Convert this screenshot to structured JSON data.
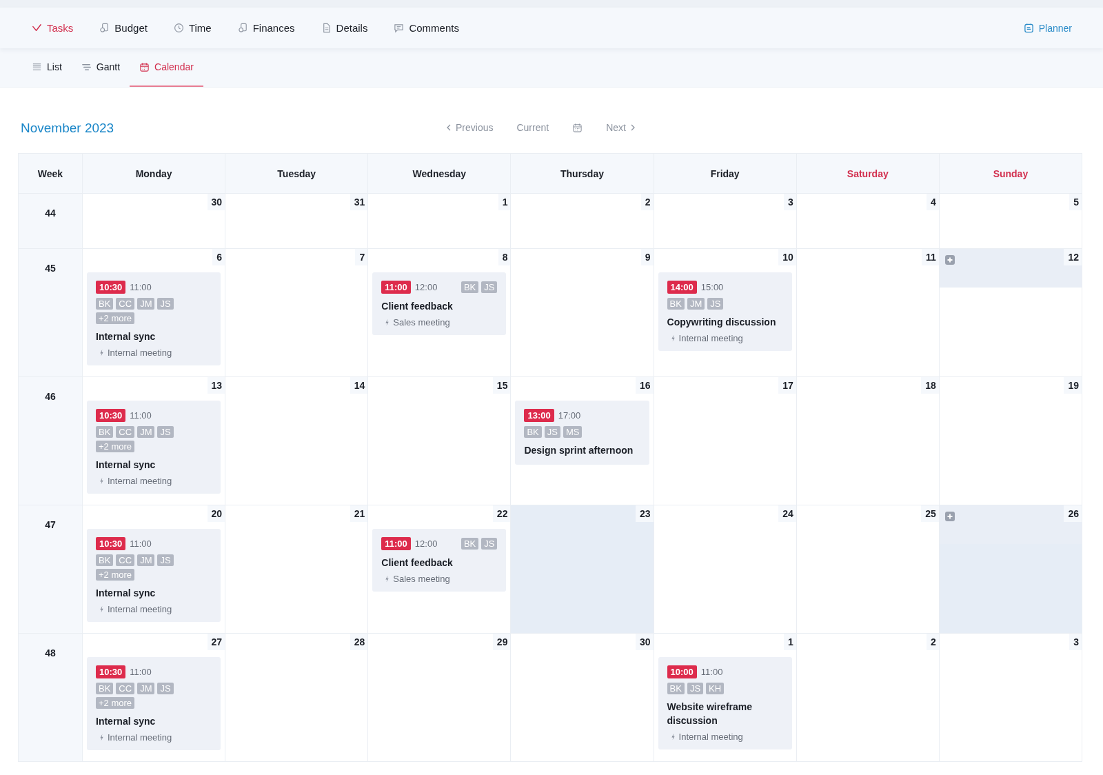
{
  "nav_tabs": [
    {
      "label": "Tasks",
      "selected": true
    },
    {
      "label": "Budget",
      "selected": false
    },
    {
      "label": "Time",
      "selected": false
    },
    {
      "label": "Finances",
      "selected": false
    },
    {
      "label": "Details",
      "selected": false
    },
    {
      "label": "Comments",
      "selected": false
    }
  ],
  "planner_link": "Planner",
  "view_tabs": [
    {
      "label": "List",
      "selected": false
    },
    {
      "label": "Gantt",
      "selected": false
    },
    {
      "label": "Calendar",
      "selected": true
    }
  ],
  "calendar": {
    "title": "November 2023",
    "previous": "Previous",
    "current": "Current",
    "next": "Next",
    "week_header": "Week",
    "columns": [
      {
        "label": "Monday",
        "weekend": false
      },
      {
        "label": "Tuesday",
        "weekend": false
      },
      {
        "label": "Wednesday",
        "weekend": false
      },
      {
        "label": "Thursday",
        "weekend": false
      },
      {
        "label": "Friday",
        "weekend": false
      },
      {
        "label": "Saturday",
        "weekend": true
      },
      {
        "label": "Sunday",
        "weekend": true
      }
    ],
    "weeks": [
      {
        "number": "44",
        "days": [
          {
            "date": "30",
            "highlighted": false,
            "add_button": false
          },
          {
            "date": "31",
            "highlighted": false,
            "add_button": false
          },
          {
            "date": "1",
            "highlighted": false,
            "add_button": false
          },
          {
            "date": "2",
            "highlighted": false,
            "add_button": false
          },
          {
            "date": "3",
            "highlighted": false,
            "add_button": false
          },
          {
            "date": "4",
            "highlighted": false,
            "add_button": false
          },
          {
            "date": "5",
            "highlighted": false,
            "add_button": false
          }
        ]
      },
      {
        "number": "45",
        "days": [
          {
            "date": "6",
            "highlighted": false,
            "add_button": false,
            "events": [
              {
                "kind": "stacked",
                "start": "10:30",
                "end": "11:00",
                "attendees": [
                  "BK",
                  "CC",
                  "JM",
                  "JS"
                ],
                "more": "+2 more",
                "title": "Internal sync",
                "type": "Internal meeting"
              }
            ]
          },
          {
            "date": "7",
            "highlighted": false,
            "add_button": false
          },
          {
            "date": "8",
            "highlighted": false,
            "add_button": false,
            "events": [
              {
                "kind": "inline",
                "start": "11:00",
                "end": "12:00",
                "attendees": [
                  "BK",
                  "JS"
                ],
                "title": "Client feedback",
                "type": "Sales meeting"
              }
            ]
          },
          {
            "date": "9",
            "highlighted": false,
            "add_button": false
          },
          {
            "date": "10",
            "highlighted": false,
            "add_button": false,
            "events": [
              {
                "kind": "stacked",
                "start": "14:00",
                "end": "15:00",
                "attendees": [
                  "BK",
                  "JM",
                  "JS"
                ],
                "title": "Copywriting discussion",
                "type": "Internal meeting"
              }
            ]
          },
          {
            "date": "11",
            "highlighted": false,
            "add_button": false
          },
          {
            "date": "12",
            "highlighted": false,
            "add_button": true
          }
        ]
      },
      {
        "number": "46",
        "days": [
          {
            "date": "13",
            "highlighted": false,
            "add_button": false,
            "events": [
              {
                "kind": "stacked",
                "start": "10:30",
                "end": "11:00",
                "attendees": [
                  "BK",
                  "CC",
                  "JM",
                  "JS"
                ],
                "more": "+2 more",
                "title": "Internal sync",
                "type": "Internal meeting"
              }
            ]
          },
          {
            "date": "14",
            "highlighted": false,
            "add_button": false
          },
          {
            "date": "15",
            "highlighted": false,
            "add_button": false
          },
          {
            "date": "16",
            "highlighted": false,
            "add_button": false,
            "events": [
              {
                "kind": "stacked",
                "start": "13:00",
                "end": "17:00",
                "attendees": [
                  "BK",
                  "JS",
                  "MS"
                ],
                "title": "Design sprint afternoon"
              }
            ]
          },
          {
            "date": "17",
            "highlighted": false,
            "add_button": false
          },
          {
            "date": "18",
            "highlighted": false,
            "add_button": false
          },
          {
            "date": "19",
            "highlighted": false,
            "add_button": false
          }
        ]
      },
      {
        "number": "47",
        "days": [
          {
            "date": "20",
            "highlighted": false,
            "add_button": false,
            "events": [
              {
                "kind": "stacked",
                "start": "10:30",
                "end": "11:00",
                "attendees": [
                  "BK",
                  "CC",
                  "JM",
                  "JS"
                ],
                "more": "+2 more",
                "title": "Internal sync",
                "type": "Internal meeting"
              }
            ]
          },
          {
            "date": "21",
            "highlighted": false,
            "add_button": false
          },
          {
            "date": "22",
            "highlighted": false,
            "add_button": false,
            "events": [
              {
                "kind": "inline",
                "start": "11:00",
                "end": "12:00",
                "attendees": [
                  "BK",
                  "JS"
                ],
                "title": "Client feedback",
                "type": "Sales meeting"
              }
            ]
          },
          {
            "date": "23",
            "highlighted": true,
            "add_button": false
          },
          {
            "date": "24",
            "highlighted": false,
            "add_button": false
          },
          {
            "date": "25",
            "highlighted": false,
            "add_button": false
          },
          {
            "date": "26",
            "highlighted": true,
            "add_button": true
          }
        ]
      },
      {
        "number": "48",
        "days": [
          {
            "date": "27",
            "highlighted": false,
            "add_button": false,
            "events": [
              {
                "kind": "stacked",
                "start": "10:30",
                "end": "11:00",
                "attendees": [
                  "BK",
                  "CC",
                  "JM",
                  "JS"
                ],
                "more": "+2 more",
                "title": "Internal sync",
                "type": "Internal meeting"
              }
            ]
          },
          {
            "date": "28",
            "highlighted": false,
            "add_button": false
          },
          {
            "date": "29",
            "highlighted": false,
            "add_button": false
          },
          {
            "date": "30",
            "highlighted": false,
            "add_button": false
          },
          {
            "date": "1",
            "highlighted": false,
            "add_button": false,
            "events": [
              {
                "kind": "stacked",
                "start": "10:00",
                "end": "11:00",
                "attendees": [
                  "BK",
                  "JS",
                  "KH"
                ],
                "title": "Website wireframe discussion",
                "type": "Internal meeting"
              }
            ]
          },
          {
            "date": "2",
            "highlighted": false,
            "add_button": false
          },
          {
            "date": "3",
            "highlighted": false,
            "add_button": false
          }
        ]
      }
    ]
  }
}
